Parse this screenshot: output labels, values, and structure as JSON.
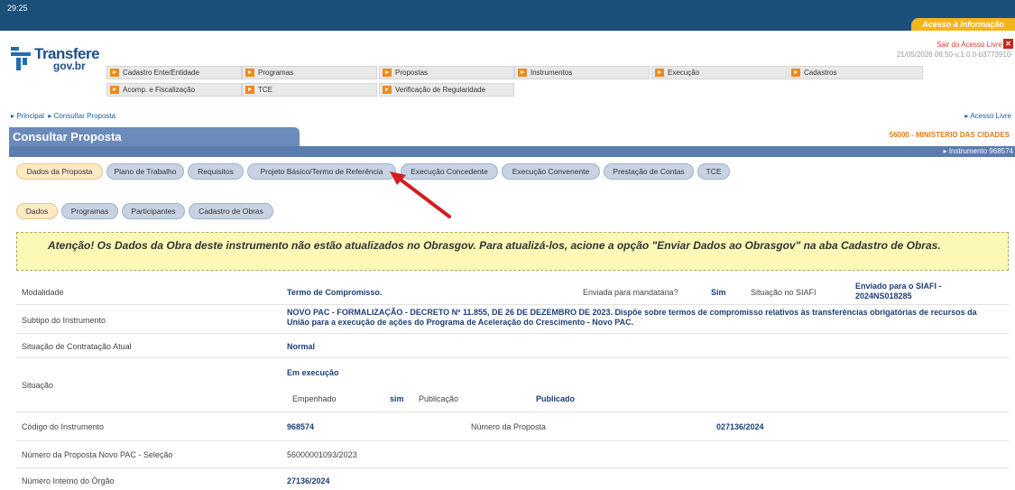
{
  "topbar": {
    "time": "29:25",
    "acesso_informacao": "Acesso à Informação"
  },
  "logo": {
    "line1": "Transfere",
    "line2": "gov.br"
  },
  "session": {
    "sair": "Sair do Acesso Livre",
    "sair_icon": "close-icon",
    "version": "21/05/2026 06:50-v.1.0.0-b3773910-"
  },
  "menu": {
    "items": [
      "Cadastro Ente/Entidade",
      "Programas",
      "Propostas",
      "Instrumentos",
      "Execução",
      "Cadastros",
      "Acomp. e Fiscalização",
      "TCE",
      "Verificação de Regularidade"
    ]
  },
  "breadcrumb": {
    "principal": "▸ Principal",
    "consultar": "▸ Consultar Proposta",
    "acesso_livre": "▸ Acesso Livre"
  },
  "page": {
    "title": "Consultar Proposta",
    "ministerio": "56000 - MINISTERIO DAS CIDADES",
    "instrumento": "▸ Instrumento 968574"
  },
  "tabs": [
    "Dados da Proposta",
    "Plano de Trabalho",
    "Requisitos",
    "Projeto Básico/Termo de Referência",
    "Execução Concedente",
    "Execução Convenente",
    "Prestação de Contas",
    "TCE"
  ],
  "subtabs": [
    "Dados",
    "Programas",
    "Participantes",
    "Cadastro de Obras"
  ],
  "alert": "Atenção! Os Dados da Obra deste instrumento não estão atualizados no Obrasgov. Para atualizá-los, acione a opção \"Enviar Dados ao Obrasgov\" na aba Cadastro de Obras.",
  "fields": {
    "modalidade_label": "Modalidade",
    "modalidade_value": "Termo de Compromisso.",
    "mandataria_label": "Enviada para mandatária?",
    "mandataria_value": "Sim",
    "siafi_label": "Situação no SIAFI",
    "siafi_value_1": "Enviado para o SIAFI -",
    "siafi_value_2": "2024NS018285",
    "subtipo_label": "Subtipo do Instrumento",
    "subtipo_value": "NOVO PAC - FORMALIZAÇÃO - DECRETO Nº 11.855, DE 26 DE DEZEMBRO DE 2023. Dispõe sobre termos de compromisso relativos às transferências obrigatórias de recursos da União para a execução de ações do Programa de Aceleração do Crescimento - Novo PAC.",
    "contratacao_label": "Situação de Contratação Atual",
    "contratacao_value": "Normal",
    "situacao_label": "Situação",
    "situacao_value": "Em execução",
    "empenhado_label": "Empenhado",
    "empenhado_value": "sim",
    "publicacao_label": "Publicação",
    "publicacao_value": "Publicado",
    "codigo_label": "Código do Instrumento",
    "codigo_value": "968574",
    "numero_proposta_label": "Número da Proposta",
    "numero_proposta_value": "027136/2024",
    "novo_pac_label": "Número da Proposta Novo PAC - Seleção",
    "novo_pac_value": "56000001093/2023",
    "interno_label": "Número Interno do Órgão",
    "interno_value": "27136/2024"
  },
  "colors": {
    "topbar": "#1b4f7a",
    "accent": "#f2b51d",
    "title_tab": "#6b8bbb",
    "link": "#1c3f78",
    "arrow": "#d11f1f"
  }
}
